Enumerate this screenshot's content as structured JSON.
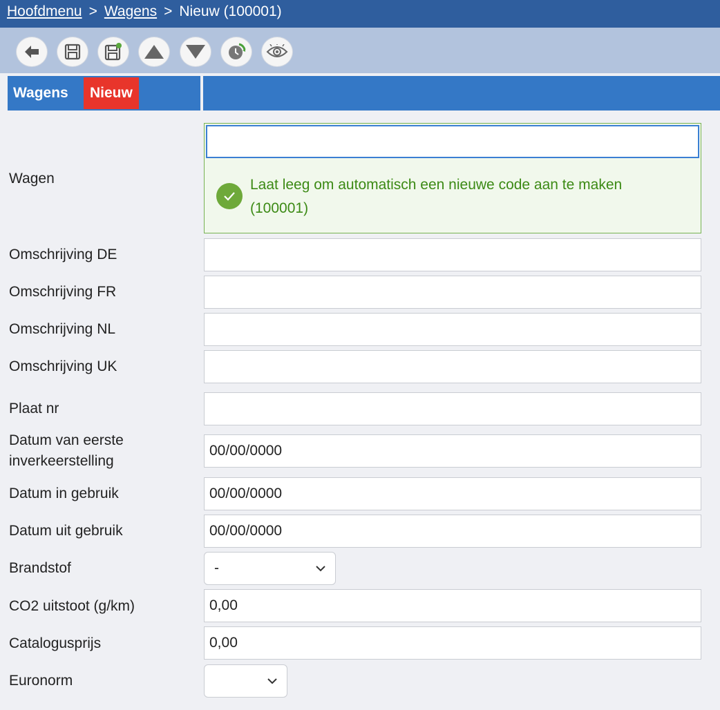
{
  "breadcrumb": {
    "home": "Hoofdmenu",
    "sep1": ">",
    "section": "Wagens",
    "sep2": ">",
    "current": "Nieuw (100001)"
  },
  "toolbar": {
    "buttons": [
      "back-arrow-icon",
      "save-icon",
      "save-new-icon",
      "up-triangle-icon",
      "down-triangle-icon",
      "history-icon",
      "eye-icon"
    ]
  },
  "section": {
    "title": "Wagens",
    "badge": "Nieuw"
  },
  "colors": {
    "topbar": "#2f5e9e",
    "toolbar": "#b2c3dd",
    "section": "#3478c6",
    "badge": "#e8352b",
    "success": "#6ea93a"
  },
  "form": {
    "wagen": {
      "label": "Wagen",
      "value": "",
      "hint": "Laat leeg om automatisch een nieuwe code aan te maken (100001)"
    },
    "omschrijving_de": {
      "label": "Omschrijving DE",
      "value": ""
    },
    "omschrijving_fr": {
      "label": "Omschrijving FR",
      "value": ""
    },
    "omschrijving_nl": {
      "label": "Omschrijving NL",
      "value": ""
    },
    "omschrijving_uk": {
      "label": "Omschrijving UK",
      "value": ""
    },
    "plaat_nr": {
      "label": "Plaat nr",
      "value": ""
    },
    "datum_eerste": {
      "label": "Datum van eerste inverkeerstelling",
      "value": "00/00/0000"
    },
    "datum_in": {
      "label": "Datum in gebruik",
      "value": "00/00/0000"
    },
    "datum_uit": {
      "label": "Datum uit gebruik",
      "value": "00/00/0000"
    },
    "brandstof": {
      "label": "Brandstof",
      "value": "-"
    },
    "co2": {
      "label": "CO2 uitstoot (g/km)",
      "value": "0,00"
    },
    "catalogusprijs": {
      "label": "Catalogusprijs",
      "value": "0,00"
    },
    "euronorm": {
      "label": "Euronorm",
      "value": ""
    }
  }
}
